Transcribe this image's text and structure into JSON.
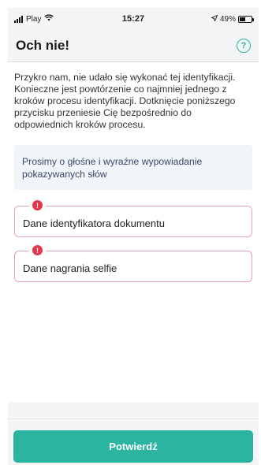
{
  "status_bar": {
    "carrier": "Play",
    "time": "15:27",
    "battery": "49%",
    "battery_level": 0.49
  },
  "header": {
    "title": "Och nie!",
    "help_icon": "question-circle"
  },
  "main": {
    "message": "Przykro nam, nie udało się wykonać tej identyfikacji. Konieczne jest powtórzenie co najmniej jednego z kroków procesu identyfikacji. Dotknięcie poniższego przycisku przeniesie Cię bezpośrednio do odpowiednich kroków procesu.",
    "hint": "Prosimy o głośne i wyraźne wypowiadanie pokazywanych słów",
    "error_items": [
      {
        "label": "Dane identyfikatora dokumentu",
        "badge": "!"
      },
      {
        "label": "Dane nagrania selfie",
        "badge": "!"
      }
    ]
  },
  "footer": {
    "confirm_label": "Potwierdź"
  },
  "colors": {
    "accent": "#2bb5a0",
    "error": "#e2364c"
  }
}
